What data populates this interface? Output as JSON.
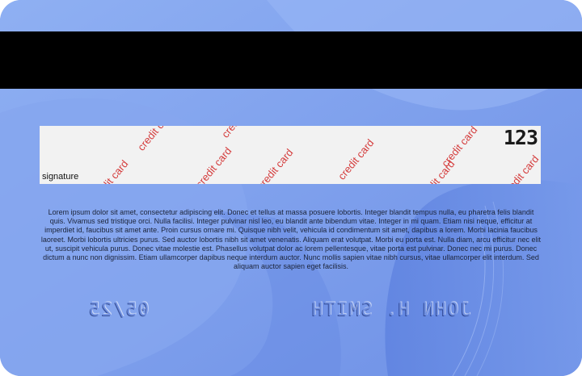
{
  "card": {
    "colors": {
      "base": "#7c9eec",
      "stripe": "#000000",
      "signature_panel": "#f2f2f2",
      "pattern_text": "#d43a3a"
    },
    "signature_panel": {
      "label": "signature",
      "pattern_text": "credit card",
      "cvv": "123"
    },
    "fine_print": "Lorem ipsum dolor sit amet, consectetur adipiscing elit. Donec et tellus at massa posuere lobortis. Integer blandit tempus nulla, eu pharetra felis blandit quis. Vivamus sed tristique orci. Nulla facilisi. Integer pulvinar nisl leo, eu blandit ante bibendum vitae. Integer in mi quam. Etiam nisi neque, efficitur at imperdiet id, faucibus sit amet ante. Proin cursus ornare mi. Quisque nibh velit, vehicula id condimentum sit amet, dapibus a lorem. Morbi lacinia faucibus laoreet. Morbi lobortis ultricies purus. Sed auctor lobortis nibh sit amet venenatis. Aliquam erat volutpat. Morbi eu porta est. Nulla diam, arcu efficitur nec elit ut, suscipit vehicula purus. Donec vitae molestie est. Phasellus volutpat dolor ac lorem pellentesque, vitae porta est pulvinar. Donec nec mi purus. Donec dictum a nunc non dignissim. Etiam ullamcorper dapibus neque interdum auctor. Nunc mollis sapien vitae nibh cursus, vitae ullamcorper elit interdum. Sed aliquam auctor sapien eget facilisis.",
    "embossed": {
      "expiry": "05/25",
      "holder_name": "JOHN H. SMITH"
    }
  }
}
